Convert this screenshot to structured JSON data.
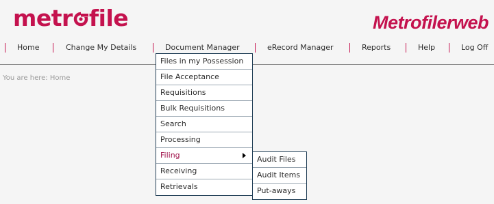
{
  "logo": {
    "text_before": "metr",
    "text_after": "file",
    "brand_color": "#c4124e"
  },
  "app_title": "Metrofilerweb",
  "nav": {
    "items": [
      "Home",
      "Change My Details",
      "Document Manager",
      "eRecord Manager",
      "Reports",
      "Help",
      "Log Off"
    ]
  },
  "breadcrumb": "You are here: Home",
  "document_menu": {
    "items": [
      "Files in my Possession",
      "File Acceptance",
      "Requisitions",
      "Bulk Requisitions",
      "Search",
      "Processing",
      "Filing",
      "Receiving",
      "Retrievals"
    ],
    "active_item": "Filing"
  },
  "filing_submenu": {
    "items": [
      "Audit Files",
      "Audit Items",
      "Put-aways"
    ]
  }
}
